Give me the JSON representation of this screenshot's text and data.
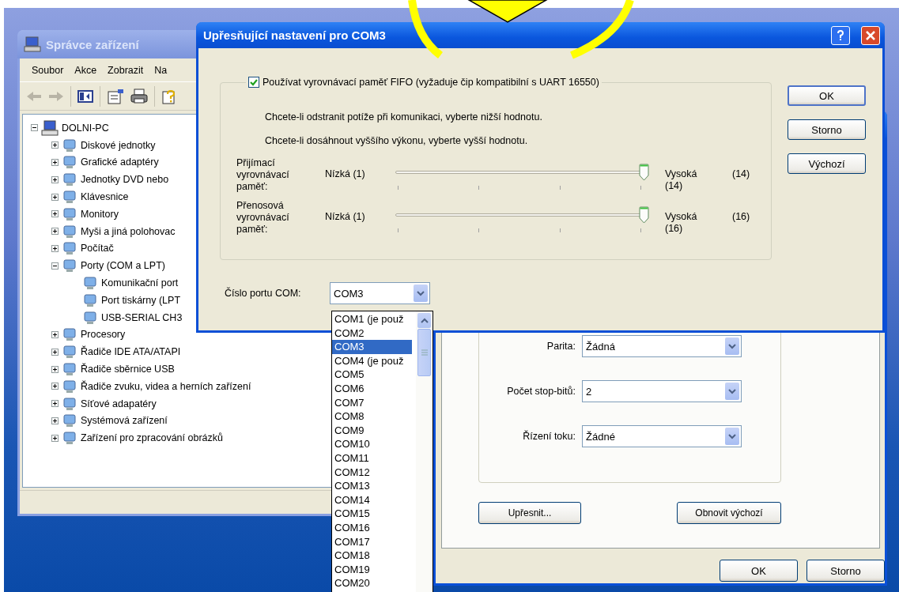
{
  "device_manager": {
    "title": "Správce zařízení",
    "menu": [
      "Soubor",
      "Akce",
      "Zobrazit",
      "Na"
    ],
    "tree": [
      {
        "label": "DOLNI-PC",
        "expanded": true,
        "children": [
          {
            "label": "Diskové jednotky",
            "expanded": false
          },
          {
            "label": "Grafické adaptéry",
            "expanded": false
          },
          {
            "label": "Jednotky DVD nebo",
            "expanded": false
          },
          {
            "label": "Klávesnice",
            "expanded": false
          },
          {
            "label": "Monitory",
            "expanded": false
          },
          {
            "label": "Myši a jiná polohovac",
            "expanded": false
          },
          {
            "label": "Počítač",
            "expanded": false
          },
          {
            "label": "Porty (COM a LPT)",
            "expanded": true,
            "children": [
              {
                "label": "Komunikační port"
              },
              {
                "label": "Port tiskárny (LPT"
              },
              {
                "label": "USB-SERIAL CH3"
              }
            ]
          },
          {
            "label": "Procesory",
            "expanded": false
          },
          {
            "label": "Řadiče IDE ATA/ATAPI",
            "expanded": false
          },
          {
            "label": "Řadiče sběrnice USB",
            "expanded": false
          },
          {
            "label": "Řadiče zvuku, videa a herních zařízení",
            "expanded": false
          },
          {
            "label": "Síťové adapatéry",
            "expanded": false
          },
          {
            "label": "Systémová zařízení",
            "expanded": false
          },
          {
            "label": "Zařízení pro zpracování obrázků",
            "expanded": false
          }
        ]
      }
    ]
  },
  "port_properties": {
    "fields": [
      {
        "label": "Parita:",
        "value": "Žádná"
      },
      {
        "label": "Počet stop-bitů:",
        "value": "2"
      },
      {
        "label": "Řízení toku:",
        "value": "Žádné"
      }
    ],
    "panel_buttons": [
      "Upřesnit...",
      "Obnovit výchozí"
    ],
    "buttons": [
      "OK",
      "Storno"
    ]
  },
  "advanced": {
    "title": "Upřesňující nastavení pro COM3",
    "fifo": {
      "label": "Používat vyrovnávací paměť FIFO (vyžaduje čip kompatibilní s UART 16550)",
      "checked": true
    },
    "hints": [
      "Chcete-li odstranit potíže při komunikaci, vyberte nižší hodnotu.",
      "Chcete-li dosáhnout vyššího výkonu, vyberte vyšší hodnotu."
    ],
    "sliders": [
      {
        "label": "Přijímací vyrovnávací paměť:",
        "low": "Nízká (1)",
        "high": "Vysoká (14)",
        "reading": "(14)",
        "level": 1
      },
      {
        "label": "Přenosová vyrovnávací paměť:",
        "low": "Nízká (1)",
        "high": "Vysoká (16)",
        "reading": "(16)",
        "level": 1
      }
    ],
    "port": {
      "label": "Číslo portu COM:",
      "value": "COM3"
    },
    "buttons": [
      "OK",
      "Storno",
      "Výchozí"
    ]
  },
  "port_list": [
    {
      "label": "COM1 (je použ",
      "selected": false
    },
    {
      "label": "COM2",
      "selected": false
    },
    {
      "label": "COM3",
      "selected": true
    },
    {
      "label": "COM4 (je použ",
      "selected": false
    },
    {
      "label": "COM5",
      "selected": false
    },
    {
      "label": "COM6",
      "selected": false
    },
    {
      "label": "COM7",
      "selected": false
    },
    {
      "label": "COM8",
      "selected": false
    },
    {
      "label": "COM9",
      "selected": false
    },
    {
      "label": "COM10",
      "selected": false
    },
    {
      "label": "COM11",
      "selected": false
    },
    {
      "label": "COM12",
      "selected": false
    },
    {
      "label": "COM13",
      "selected": false
    },
    {
      "label": "COM14",
      "selected": false
    },
    {
      "label": "COM15",
      "selected": false
    },
    {
      "label": "COM16",
      "selected": false
    },
    {
      "label": "COM17",
      "selected": false
    },
    {
      "label": "COM18",
      "selected": false
    },
    {
      "label": "COM19",
      "selected": false
    },
    {
      "label": "COM20",
      "selected": false
    }
  ]
}
